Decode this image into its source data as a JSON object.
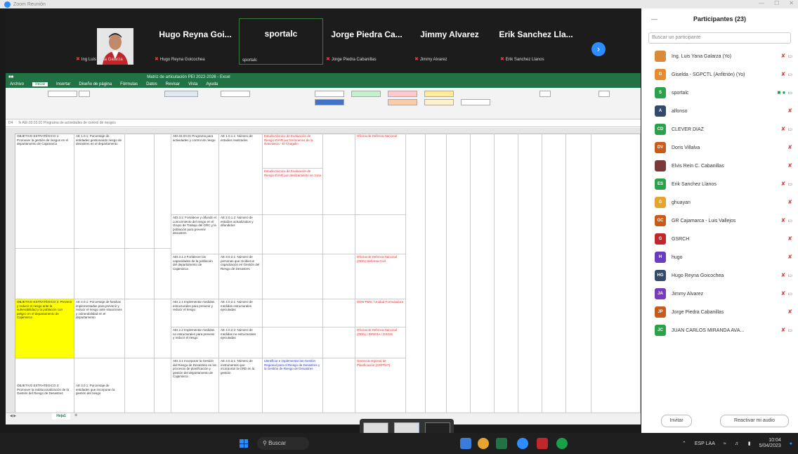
{
  "window": {
    "title": "Zoom Reunión"
  },
  "gallery": {
    "tiles": [
      {
        "name": "",
        "sub": "Ing Luis Yana Galarza"
      },
      {
        "name": "Hugo Reyna Goi...",
        "sub": "Hugo Reyna Goicochea"
      },
      {
        "name": "sportalc",
        "sub": "sportalc"
      },
      {
        "name": "Jorge Piedra Ca...",
        "sub": "Jorge Piedra Cabanillas"
      },
      {
        "name": "Jimmy Alvarez",
        "sub": "Jimmy Alvarez"
      },
      {
        "name": "Erik Sanchez Lla...",
        "sub": "Erik Sanchez Llanos"
      }
    ]
  },
  "excel": {
    "title": "Matriz de articulación PEI 2022-2026 - Excel",
    "tabs": [
      "Archivo",
      "Inicio",
      "Insertar",
      "Diseño de página",
      "Fórmulas",
      "Datos",
      "Revisar",
      "Vista",
      "Ayuda"
    ],
    "active_tab": "Inicio",
    "cell_ref": "D4",
    "formula": "fx  AEI.03.03.01 Programa de actividades de control de riesgos",
    "sheet_tab": "Hoja1",
    "rows": [
      {
        "a": "OBJETIVO ESTRATÉGICO 1: Promover la gestión de riesgos en el departamento de Cajamarca",
        "b": "AE 1.0.1: Porcentaje de entidades gestionando riesgo de desastres en el departamento",
        "d": "AEI.03.03.01 Programa para actividades y control de riesgo",
        "e": "AE 1.0.1.1: Número de estudios realizados",
        "f": "Estudio técnico de Evaluación de Riesgo EVAR por fenómenos de la Naturaleza - El Chagallo",
        "g": "Oficina de Defensa Nacional"
      },
      {
        "f": "Estudio técnico de Evaluación de Riesgo EVAR por deslizamiento en zona"
      },
      {
        "d": "AEI.3.1: Fortalecer y difundir el conocimiento del riesgo en el Grupo de Trabajo del GRC y la población para prevenir desastres",
        "e": "AE 2.0.1.2: Número de estudios actualizados y difundidos"
      },
      {
        "d": "AEI.3.1.2 Fortalecer las capacidades de la población del departamento de Cajamarca",
        "e": "AE 3.0.2.1: Número de personas que recibieron capacitación en Gestión del Riesgo de Desastres",
        "g": "Oficina de Defensa Nacional (ODN) Defensa Civil"
      },
      {
        "a": "OBJETIVO ESTRATÉGICO 2: Prevenir y reducir el riesgo ante la vulnerabilidad y la población con peligro en el departamento de Cajamarca",
        "b": "AE 2.0.1: Porcentaje de familias implementadas para prevenir y reducir el riesgo ante situaciones y vulnerabilidad en el departamento",
        "d": "AEI.2.1 Implementar medidas estructurales para prevenir y reducir el riesgo",
        "e": "AE 4.0.2.1: Número de medidas estructurales ejecutadas",
        "g": "ODN-PMS / Unidad Formuladora"
      },
      {
        "d": "AEI.2.2 Implementar medidas no estructurales para prevenir y reducir el riesgo",
        "e": "AE 4.0.2.2: Número de medidas no estructurales ejecutadas",
        "g": "Oficina de Defensa Nacional (ODN) / DIRESA / OSGIS"
      },
      {
        "a": "OBJETIVO ESTRATÉGICO 3: Promover la institucionalización de la Gestión del Riesgo de Desastres",
        "b": "AE 3.0.1: Porcentaje de entidades que incorporan la gestión del riesgo",
        "d": "AEI.3.1 Incorporar la Gestión del Riesgo de Desastres en los procesos de planificación y gestión del departamento de Cajamarca",
        "e": "AE 4.0.3.1: Número de instrumentos que incorporan la GRD en la gestión",
        "f": "Identificar e implementar las Gestión Regional para el Riesgo de Desastres y la Gestión de Riesgo de Desastres",
        "g": "Gerencia regional de Planificación (GRPPAT)"
      }
    ]
  },
  "participants": {
    "title": "Participantes (23)",
    "search_placeholder": "Buscar un participante",
    "list": [
      {
        "initials": "",
        "name": "Ing. Luis Yana Galarza (Yo)",
        "color": "#d98a3a",
        "mic": "muted",
        "cam": "off"
      },
      {
        "initials": "G",
        "name": "Giselda - SGPCTL (Anfitrión) (Yo)",
        "color": "#e88a2e",
        "mic": "muted",
        "cam": "off"
      },
      {
        "initials": "S",
        "name": "sportalc",
        "color": "#2aa24a",
        "mic": "on",
        "cam": "on"
      },
      {
        "initials": "A",
        "name": "alfonso",
        "color": "#334a6b",
        "mic": "muted",
        "cam": ""
      },
      {
        "initials": "CD",
        "name": "CLEVER DIAZ",
        "color": "#2aa24a",
        "mic": "muted",
        "cam": "off"
      },
      {
        "initials": "DV",
        "name": "Doris Villalva",
        "color": "#c85a1a",
        "mic": "muted",
        "cam": ""
      },
      {
        "initials": "",
        "name": "Elvis Rein C. Cabanillas",
        "color": "#7a3a3a",
        "mic": "muted",
        "cam": ""
      },
      {
        "initials": "ES",
        "name": "Erik Sanchez Llanos",
        "color": "#2aa24a",
        "mic": "muted",
        "cam": "off"
      },
      {
        "initials": "G",
        "name": "ghuayan",
        "color": "#e8a22e",
        "mic": "muted",
        "cam": ""
      },
      {
        "initials": "GC",
        "name": "GR Cajamarca - Luis Vallejos",
        "color": "#c85a1a",
        "mic": "muted",
        "cam": "off"
      },
      {
        "initials": "G",
        "name": "GSRCH",
        "color": "#c0262a",
        "mic": "muted",
        "cam": ""
      },
      {
        "initials": "H",
        "name": "hugo",
        "color": "#6a3ac0",
        "mic": "muted",
        "cam": ""
      },
      {
        "initials": "HG",
        "name": "Hugo Reyna Goicochea",
        "color": "#334a6b",
        "mic": "muted",
        "cam": "off"
      },
      {
        "initials": "JA",
        "name": "Jimmy Alvarez",
        "color": "#7a3ac0",
        "mic": "muted",
        "cam": "off"
      },
      {
        "initials": "JP",
        "name": "Jorge Piedra Cabanillas",
        "color": "#c85a1a",
        "mic": "muted",
        "cam": ""
      },
      {
        "initials": "JC",
        "name": "JUAN CARLOS MIRANDA AVA...",
        "color": "#2aa24a",
        "mic": "muted",
        "cam": "off"
      }
    ],
    "invite_label": "Invitar",
    "unmute_label": "Reactivar mi audio"
  },
  "taskbar": {
    "search_label": "Buscar",
    "time": "10:04",
    "date": "5/04/2023",
    "lang": "ESP LAA"
  }
}
